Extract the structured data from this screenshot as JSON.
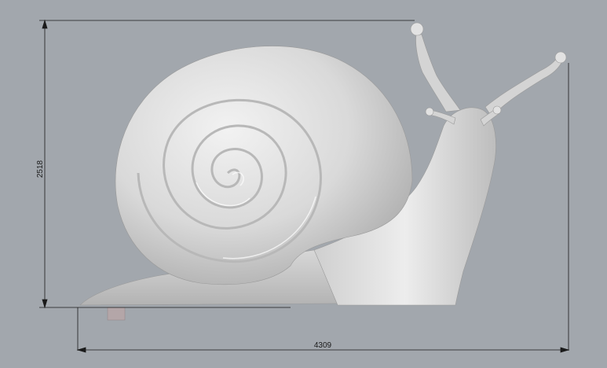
{
  "viewport": {
    "background": "#a2a7ad",
    "model_color": "#d8d8d8"
  },
  "dimensions": {
    "height_label": "2518",
    "width_label": "4309"
  }
}
